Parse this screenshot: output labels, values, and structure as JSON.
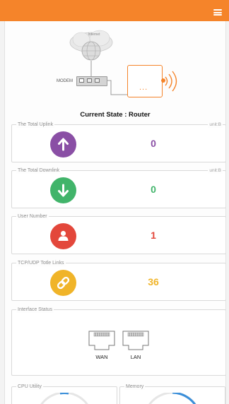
{
  "header": {
    "menu_icon": "hamburger-icon",
    "accent": "#f5842a"
  },
  "diagram": {
    "cloud_label": "Internet",
    "modem_label": "MODEM",
    "router_dots": "...",
    "icons": [
      "cloud-globe-icon",
      "modem-icon",
      "router-icon",
      "wifi-signal-icon"
    ]
  },
  "state_title": "Current State : Router",
  "cards": [
    {
      "legend": "The Total Uplink",
      "unit": "unit:B",
      "value": "0",
      "icon": "arrow-up-icon",
      "color": "#8a4fa5"
    },
    {
      "legend": "The Total Downlink",
      "unit": "unit:B",
      "value": "0",
      "icon": "arrow-down-icon",
      "color": "#41b46a"
    },
    {
      "legend": "User Number",
      "unit": "",
      "value": "1",
      "icon": "user-icon",
      "color": "#e3473b"
    },
    {
      "legend": "TCP/UDP Totle Links",
      "unit": "",
      "value": "36",
      "icon": "link-icon",
      "color": "#f0b429"
    }
  ],
  "interface": {
    "legend": "Interface Status",
    "ports": [
      {
        "label": "WAN"
      },
      {
        "label": "LAN"
      }
    ]
  },
  "gauges": [
    {
      "legend": "CPU Utility",
      "color": "#3b8fd9"
    },
    {
      "legend": "Memory",
      "color": "#3b8fd9"
    }
  ]
}
